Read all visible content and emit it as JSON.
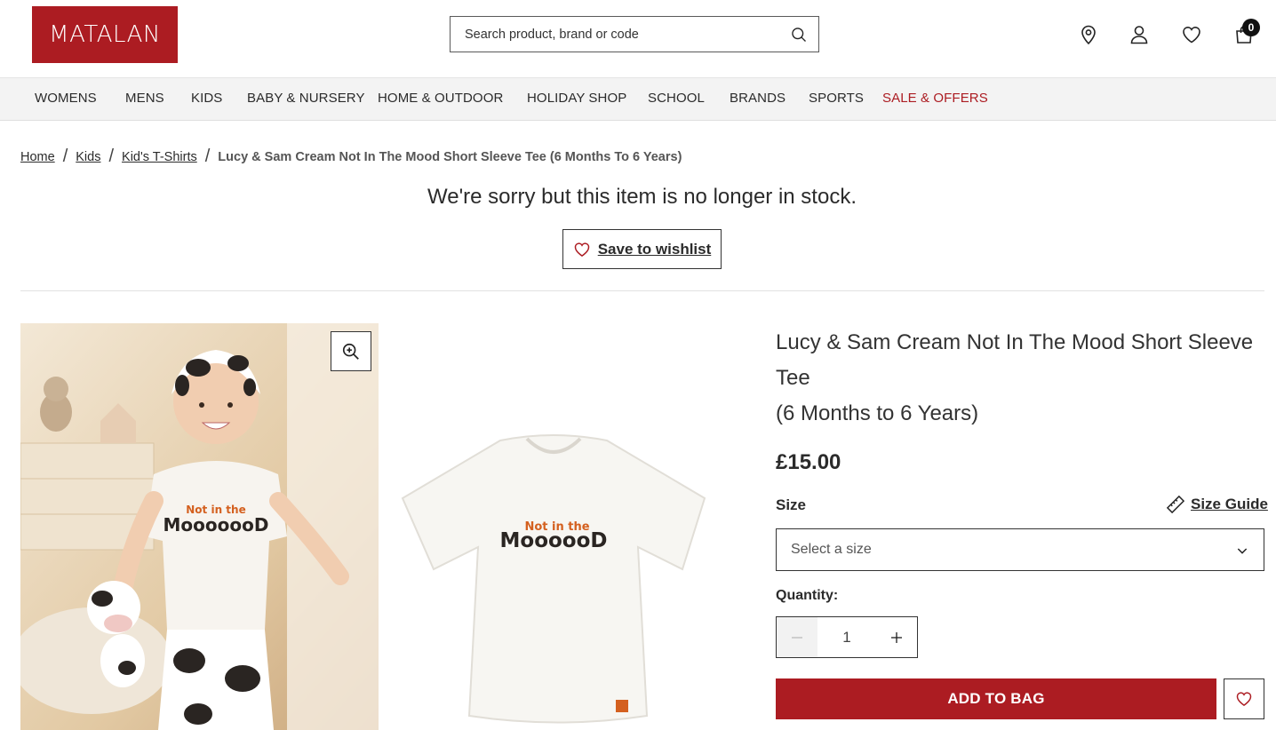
{
  "header": {
    "logo": "MATALAN",
    "search_placeholder": "Search product, brand or code",
    "cart_count": "0"
  },
  "nav": {
    "items": [
      "WOMENS",
      "MENS",
      "KIDS",
      "BABY & NURSERY",
      "HOME & OUTDOOR",
      "HOLIDAY SHOP",
      "SCHOOL",
      "BRANDS",
      "SPORTS",
      "SALE & OFFERS"
    ]
  },
  "breadcrumb": {
    "links": [
      "Home",
      "Kids",
      "Kid's T-Shirts"
    ],
    "current": "Lucy & Sam Cream Not In The Mood Short Sleeve Tee (6 Months To 6 Years)"
  },
  "notice": {
    "message": "We're sorry but this item is no longer in stock.",
    "wishlist_label": "Save to wishlist"
  },
  "product": {
    "print_text_top": "Not in the",
    "print_text_bottom": "MooooooD",
    "print_text_bottom2": "MoooooD",
    "title_line1": "Lucy & Sam Cream Not In The Mood Short Sleeve Tee",
    "title_line2": "(6 Months to 6 Years)",
    "price": "£15.00",
    "size_label": "Size",
    "size_guide_label": "Size Guide",
    "size_placeholder": "Select a size",
    "quantity_label": "Quantity:",
    "quantity_value": "1",
    "add_to_bag_label": "ADD TO BAG"
  },
  "colors": {
    "brand": "#ac1c22",
    "nav_background": "#f3f3f3",
    "print_orange": "#d4601f"
  }
}
